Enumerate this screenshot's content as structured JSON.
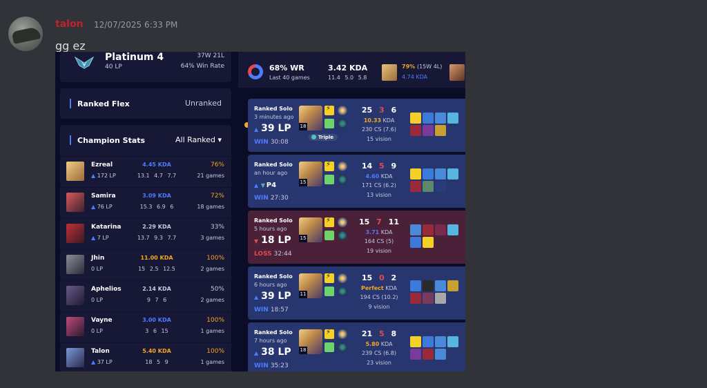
{
  "message": {
    "username": "talon",
    "timestamp": "12/07/2025 6:33 PM",
    "text": "gg ez"
  },
  "profile": {
    "solo_rank": "Platinum 4",
    "solo_lp": "40 LP",
    "solo_wl": "37W 21L",
    "solo_winrate": "64% Win Rate",
    "flex_title": "Ranked Flex",
    "flex_value": "Unranked",
    "champ_stats_title": "Champion Stats",
    "champ_filter": "All Ranked ▾"
  },
  "champions": [
    {
      "name": "Ezreal",
      "lp": "172 LP",
      "lp_arrow": "up",
      "kda": "4.45 KDA",
      "kda_color": "#4f7bff",
      "avg": "13.1 4.7 7.7",
      "wr": "76%",
      "wr_color": "#f5a623",
      "games": "21 games",
      "color1": "#f0cd85",
      "color2": "#9a6b3b"
    },
    {
      "name": "Samira",
      "lp": "76 LP",
      "lp_arrow": "up",
      "kda": "3.09 KDA",
      "kda_color": "#4f7bff",
      "avg": "15.3 6.9 6",
      "wr": "72%",
      "wr_color": "#f5a623",
      "games": "18 games",
      "color1": "#d95a5a",
      "color2": "#3a2230"
    },
    {
      "name": "Katarina",
      "lp": "7 LP",
      "lp_arrow": "up",
      "kda": "2.29 KDA",
      "kda_color": "#c8cbe0",
      "avg": "13.7 9.3 7.7",
      "wr": "33%",
      "wr_color": "#c8cbe0",
      "games": "3 games",
      "color1": "#c0303a",
      "color2": "#3a1a22"
    },
    {
      "name": "Jhin",
      "lp": "0 LP",
      "lp_arrow": "",
      "kda": "11.00 KDA",
      "kda_color": "#f5a623",
      "avg": "15 2.5 12.5",
      "wr": "100%",
      "wr_color": "#f5a623",
      "games": "2 games",
      "color1": "#8a8f9a",
      "color2": "#2a2c38"
    },
    {
      "name": "Aphelios",
      "lp": "0 LP",
      "lp_arrow": "",
      "kda": "2.14 KDA",
      "kda_color": "#c8cbe0",
      "avg": "9 7 6",
      "wr": "50%",
      "wr_color": "#c8cbe0",
      "games": "2 games",
      "color1": "#6a5a8a",
      "color2": "#1e1a30"
    },
    {
      "name": "Vayne",
      "lp": "0 LP",
      "lp_arrow": "",
      "kda": "3.00 KDA",
      "kda_color": "#4f7bff",
      "avg": "3 6 15",
      "wr": "100%",
      "wr_color": "#f5a623",
      "games": "1 games",
      "color1": "#c04a7a",
      "color2": "#2a1a30"
    },
    {
      "name": "Talon",
      "lp": "37 LP",
      "lp_arrow": "up",
      "kda": "5.40 KDA",
      "kda_color": "#f5a623",
      "avg": "18 5 9",
      "wr": "100%",
      "wr_color": "#f5a623",
      "games": "1 games",
      "color1": "#7a9ad8",
      "color2": "#2a2a4a"
    }
  ],
  "summary": {
    "winrate": "68% WR",
    "games": "Last 40 games",
    "kda": "3.42 KDA",
    "avg": "11.4 5.0 5.8",
    "top_champ_wr": "79%",
    "top_champ_record": "(15W 4L)",
    "top_champ_kda": "4.74 KDA"
  },
  "matches": [
    {
      "result": "win",
      "queue": "Ranked Solo",
      "ago": "3 minutes ago",
      "lp": "39 LP",
      "lp_arrow": "up",
      "res_label": "WIN",
      "duration": "30:08",
      "level": "18",
      "k": "25",
      "d": "3",
      "a": "6",
      "kda": "10.33",
      "kda_color": "#f5a623",
      "kda_suffix": " KDA",
      "cs": "230 CS (7.6)",
      "vision": "15 vision",
      "badge": "Triple"
    },
    {
      "result": "win",
      "queue": "Ranked Solo",
      "ago": "an hour ago",
      "lp": "P4",
      "lp_arrow": "up",
      "promo": true,
      "res_label": "WIN",
      "duration": "27:30",
      "level": "15",
      "k": "14",
      "d": "5",
      "a": "9",
      "kda": "4.60",
      "kda_color": "#4f7bff",
      "kda_suffix": " KDA",
      "cs": "171 CS (6.2)",
      "vision": "13 vision"
    },
    {
      "result": "loss",
      "queue": "Ranked Solo",
      "ago": "5 hours ago",
      "lp": "18 LP",
      "lp_arrow": "down",
      "res_label": "LOSS",
      "duration": "32:44",
      "level": "15",
      "k": "15",
      "d": "7",
      "a": "11",
      "kda": "3.71",
      "kda_color": "#4f7bff",
      "kda_suffix": " KDA",
      "cs": "164 CS (5)",
      "vision": "19 vision"
    },
    {
      "result": "win",
      "queue": "Ranked Solo",
      "ago": "6 hours ago",
      "lp": "39 LP",
      "lp_arrow": "up",
      "res_label": "WIN",
      "duration": "18:57",
      "level": "11",
      "k": "15",
      "d": "0",
      "a": "2",
      "kda": "Perfect",
      "kda_color": "#f5a623",
      "kda_suffix": " KDA",
      "cs": "194 CS (10.2)",
      "vision": "9 vision"
    },
    {
      "result": "win",
      "queue": "Ranked Solo",
      "ago": "7 hours ago",
      "lp": "38 LP",
      "lp_arrow": "up",
      "res_label": "WIN",
      "duration": "35:23",
      "level": "18",
      "k": "21",
      "d": "5",
      "a": "8",
      "kda": "5.80",
      "kda_color": "#f5a623",
      "kda_suffix": " KDA",
      "cs": "239 CS (6.8)",
      "vision": "23 vision"
    }
  ],
  "colors": {
    "win_bg": "#27366f",
    "loss_bg": "#4a2138",
    "accent_blue": "#4f7bff",
    "accent_red": "#e14a53",
    "accent_gold": "#f5a623"
  }
}
